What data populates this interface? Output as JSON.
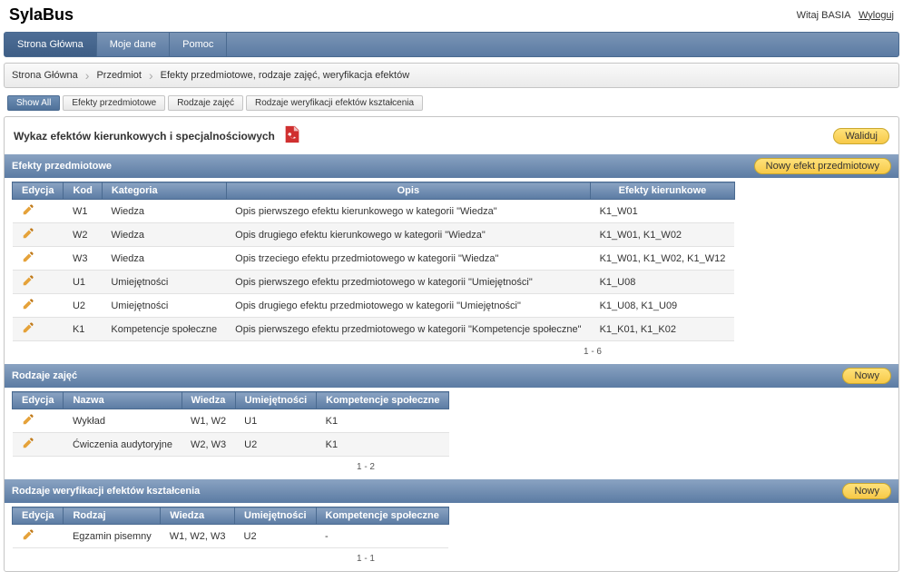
{
  "app_title": "SylaBus",
  "user": {
    "welcome": "Witaj",
    "name": "BASIA",
    "logout": "Wyloguj"
  },
  "nav": {
    "home": "Strona Główna",
    "mydata": "Moje dane",
    "help": "Pomoc"
  },
  "breadcrumb": {
    "b0": "Strona Główna",
    "b1": "Przedmiot",
    "b2": "Efekty przedmiotowe, rodzaje zajęć, weryfikacja efektów"
  },
  "tabs": {
    "showall": "Show All",
    "t1": "Efekty przedmiotowe",
    "t2": "Rodzaje zajęć",
    "t3": "Rodzaje weryfikacji efektów kształcenia"
  },
  "panel": {
    "title": "Wykaz efektów kierunkowych i specjalnościowych",
    "validate": "Waliduj"
  },
  "section_effects": {
    "title": "Efekty przedmiotowe",
    "new_btn": "Nowy efekt przedmiotowy",
    "cols": {
      "edit": "Edycja",
      "code": "Kod",
      "cat": "Kategoria",
      "desc": "Opis",
      "dir": "Efekty kierunkowe"
    },
    "rows": [
      {
        "code": "W1",
        "cat": "Wiedza",
        "desc": "Opis pierwszego efektu kierunkowego w kategorii \"Wiedza\"",
        "dir": "K1_W01"
      },
      {
        "code": "W2",
        "cat": "Wiedza",
        "desc": "Opis drugiego efektu kierunkowego w kategorii \"Wiedza\"",
        "dir": "K1_W01, K1_W02"
      },
      {
        "code": "W3",
        "cat": "Wiedza",
        "desc": "Opis trzeciego efektu przedmiotowego w kategorii \"Wiedza\"",
        "dir": "K1_W01, K1_W02, K1_W12"
      },
      {
        "code": "U1",
        "cat": "Umiejętności",
        "desc": "Opis pierwszego efektu przedmiotowego w kategorii \"Umiejętności\"",
        "dir": "K1_U08"
      },
      {
        "code": "U2",
        "cat": "Umiejętności",
        "desc": "Opis drugiego efektu przedmiotowego w kategorii \"Umiejętności\"",
        "dir": "K1_U08, K1_U09"
      },
      {
        "code": "K1",
        "cat": "Kompetencje społeczne",
        "desc": "Opis pierwszego efektu przedmiotowego w kategorii \"Kompetencje społeczne\"",
        "dir": "K1_K01, K1_K02"
      }
    ],
    "pager": "1 - 6"
  },
  "section_classes": {
    "title": "Rodzaje zajęć",
    "new_btn": "Nowy",
    "cols": {
      "edit": "Edycja",
      "name": "Nazwa",
      "wiedza": "Wiedza",
      "um": "Umiejętności",
      "komp": "Kompetencje społeczne"
    },
    "rows": [
      {
        "name": "Wykład",
        "wiedza": "W1, W2",
        "um": "U1",
        "komp": "K1"
      },
      {
        "name": "Ćwiczenia audytoryjne",
        "wiedza": "W2, W3",
        "um": "U2",
        "komp": "K1"
      }
    ],
    "pager": "1 - 2"
  },
  "section_verify": {
    "title": "Rodzaje weryfikacji efektów kształcenia",
    "new_btn": "Nowy",
    "cols": {
      "edit": "Edycja",
      "type": "Rodzaj",
      "wiedza": "Wiedza",
      "um": "Umiejętności",
      "komp": "Kompetencje społeczne"
    },
    "rows": [
      {
        "type": "Egzamin pisemny",
        "wiedza": "W1, W2, W3",
        "um": "U2",
        "komp": "-"
      }
    ],
    "pager": "1 - 1"
  }
}
